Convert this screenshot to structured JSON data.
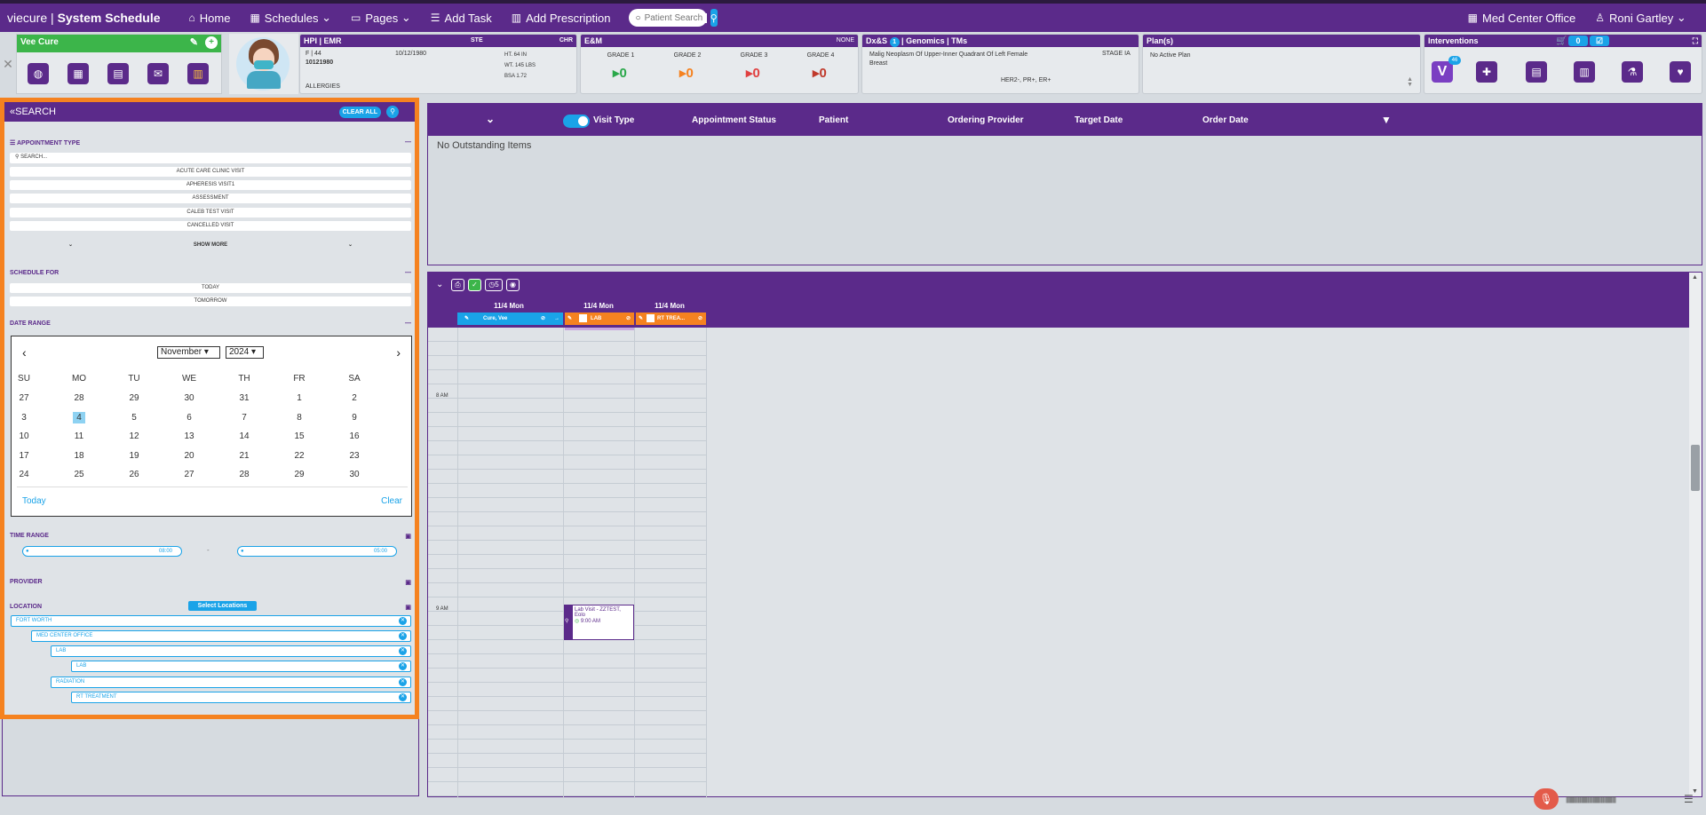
{
  "app": {
    "brand": "viecure",
    "title": "System Schedule"
  },
  "nav": {
    "home": "Home",
    "schedules": "Schedules",
    "pages": "Pages",
    "add_task": "Add Task",
    "add_prescription": "Add Prescription",
    "patient_search_placeholder": "Patient Search",
    "office": "Med Center Office",
    "user": "Roni Gartley"
  },
  "patient": {
    "name": "Vee Cure",
    "hpi_title": "HPI | EMR",
    "sex_age": "F | 44",
    "dob": "10/12/1980",
    "mrn": "10121980",
    "ste": "STE",
    "chr": "CHR",
    "ht": "HT. 64 IN",
    "wt": "WT. 145 LBS",
    "bsa": "BSA 1.72",
    "allergies": "ALLERGIES"
  },
  "em": {
    "title": "E&M",
    "none": "NONE",
    "grades": [
      {
        "label": "GRADE 1",
        "value": "0",
        "color": "#2aa84a"
      },
      {
        "label": "GRADE 2",
        "value": "0",
        "color": "#f58220"
      },
      {
        "label": "GRADE 3",
        "value": "0",
        "color": "#e04040"
      },
      {
        "label": "GRADE 4",
        "value": "0",
        "color": "#c0392b"
      }
    ]
  },
  "dx": {
    "title_a": "Dx&S",
    "badge": "1",
    "title_b": "| Genomics | TMs",
    "diagnosis": "Malig Neoplasm Of Upper-Inner Quadrant Of Left Female Breast",
    "stage": "STAGE IA",
    "markers": "HER2-, PR+, ER+"
  },
  "plan": {
    "title": "Plan(s)",
    "text": "No Active Plan"
  },
  "interventions": {
    "title": "Interventions",
    "cart_count": "0",
    "v_badge": "46"
  },
  "search": {
    "title": "SEARCH",
    "clear_all": "CLEAR ALL",
    "appointment_type": {
      "label": "APPOINTMENT TYPE",
      "placeholder": "SEARCH...",
      "items": [
        "ACUTE CARE CLINIC VISIT",
        "APHERESIS VISIT1",
        "ASSESSMENT",
        "CALEB TEST VISIT",
        "CANCELLED VISIT"
      ],
      "show_more": "SHOW MORE"
    },
    "schedule_for": {
      "label": "SCHEDULE FOR",
      "items": [
        "TODAY",
        "TOMORROW"
      ]
    },
    "date_range": {
      "label": "DATE RANGE",
      "month": "November",
      "year": "2024",
      "dow": [
        "SU",
        "MO",
        "TU",
        "WE",
        "TH",
        "FR",
        "SA"
      ],
      "weeks": [
        [
          "27",
          "28",
          "29",
          "30",
          "31",
          "1",
          "2"
        ],
        [
          "3",
          "4",
          "5",
          "6",
          "7",
          "8",
          "9"
        ],
        [
          "10",
          "11",
          "12",
          "13",
          "14",
          "15",
          "16"
        ],
        [
          "17",
          "18",
          "19",
          "20",
          "21",
          "22",
          "23"
        ],
        [
          "24",
          "25",
          "26",
          "27",
          "28",
          "29",
          "30"
        ]
      ],
      "selected": "4",
      "today": "Today",
      "clear": "Clear"
    },
    "time_range": {
      "label": "TIME RANGE",
      "start": "08:00",
      "end": "05:00",
      "sep": "-"
    },
    "provider": {
      "label": "PROVIDER"
    },
    "location": {
      "label": "LOCATION",
      "select": "Select Locations",
      "items": [
        "FORT WORTH",
        "MED CENTER OFFICE",
        "LAB",
        "LAB",
        "RADIATION",
        "RT TREATMENT"
      ]
    }
  },
  "outstanding": {
    "visit_type": "Visit Type",
    "headers": [
      "Appointment Status",
      "Patient",
      "Ordering Provider",
      "Target Date",
      "Order Date"
    ],
    "empty": "No Outstanding Items"
  },
  "schedule": {
    "badge": "5",
    "columns": [
      {
        "date": "11/4 Mon",
        "name": "Cure, Vee",
        "color": "#1aa3e8"
      },
      {
        "date": "11/4 Mon",
        "name": "LAB",
        "color": "#f58220"
      },
      {
        "date": "11/4 Mon",
        "name": "RT TREA...",
        "color": "#f58220"
      }
    ],
    "times": [
      "8 AM",
      "9 AM"
    ],
    "appointment": {
      "title": "Lab Visit - ZZTEST, Eolo",
      "time": "9:00 AM"
    }
  }
}
